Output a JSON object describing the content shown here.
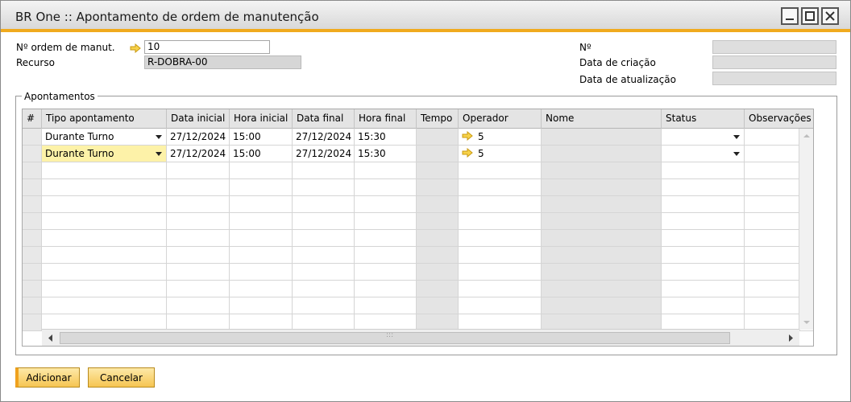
{
  "window": {
    "title": "BR One :: Apontamento de ordem de manutenção"
  },
  "header": {
    "order_label": "Nº ordem de manut.",
    "order_value": "10",
    "resource_label": "Recurso",
    "resource_value": "R-DOBRA-00",
    "number_label": "Nº",
    "number_value": "",
    "created_label": "Data de criação",
    "created_value": "",
    "updated_label": "Data de atualização",
    "updated_value": ""
  },
  "apontamentos": {
    "group_title": "Apontamentos",
    "columns": [
      "#",
      "Tipo apontamento",
      "Data inicial",
      "Hora inicial",
      "Data final",
      "Hora final",
      "Tempo",
      "Operador",
      "Nome",
      "Status",
      "Observações"
    ],
    "rows": [
      {
        "num": "",
        "tipo": "Durante Turno",
        "data_inicial": "27/12/2024",
        "hora_inicial": "15:00",
        "data_final": "27/12/2024",
        "hora_final": "15:30",
        "tempo": "",
        "operador": "5",
        "nome": "",
        "status": "",
        "observacoes": ""
      },
      {
        "num": "",
        "tipo": "Durante Turno",
        "data_inicial": "27/12/2024",
        "hora_inicial": "15:00",
        "data_final": "27/12/2024",
        "hora_final": "15:30",
        "tempo": "",
        "operador": "5",
        "nome": "",
        "status": "",
        "observacoes": ""
      }
    ],
    "hscroll_center_glyph": ":::"
  },
  "footer": {
    "add_label": "Adicionar",
    "cancel_label": "Cancelar"
  },
  "colors": {
    "accent": "#f0aa1e",
    "selected_row": "#fdf2a8",
    "button_fill": "#f6c552",
    "readonly_field": "#d6d6d6"
  },
  "icons": {
    "link_arrow": "link-arrow-icon",
    "dropdown": "dropdown-arrow-icon",
    "minimize": "minimize-icon",
    "maximize": "maximize-icon",
    "close": "close-icon",
    "scroll_up": "scroll-up-icon",
    "scroll_down": "scroll-down-icon",
    "scroll_left": "scroll-left-icon",
    "scroll_right": "scroll-right-icon"
  }
}
